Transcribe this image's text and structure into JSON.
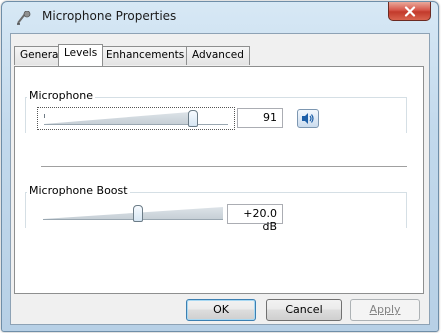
{
  "window": {
    "title": "Microphone Properties",
    "icon": "microphone-icon",
    "close_icon": "close-icon"
  },
  "tabs": [
    {
      "label": "General",
      "active": false
    },
    {
      "label": "Levels",
      "active": true
    },
    {
      "label": "Enhancements",
      "active": false
    },
    {
      "label": "Advanced",
      "active": false
    }
  ],
  "levels": {
    "microphone": {
      "label": "Microphone",
      "value": "91",
      "level_fraction": 0.91,
      "mute_icon": "speaker-icon"
    },
    "boost": {
      "label": "Microphone Boost",
      "value": "+20.0 dB",
      "level_fraction": 0.5
    }
  },
  "buttons": {
    "ok": "OK",
    "cancel": "Cancel",
    "apply": "Apply"
  },
  "colors": {
    "close_button": "#c23a2b",
    "window_frame": "#b7d0e6",
    "accent": "#3c7fb1"
  }
}
